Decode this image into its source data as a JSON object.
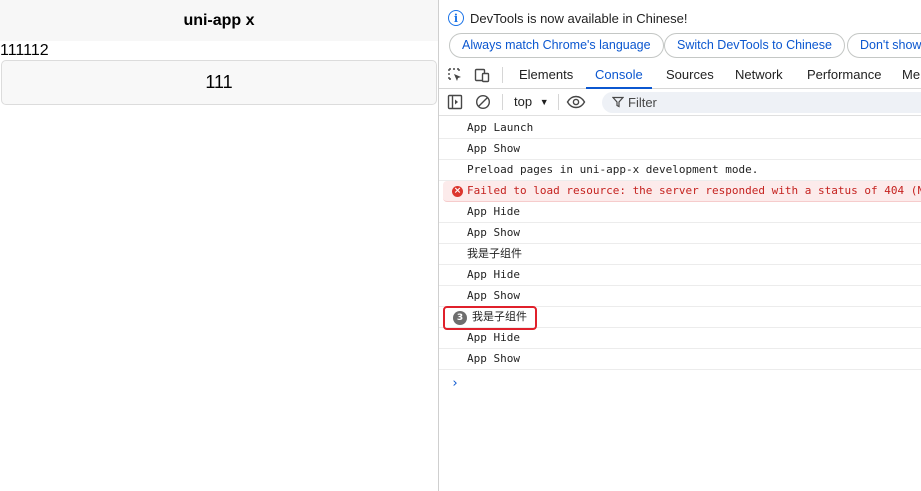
{
  "app": {
    "nav_title": "uni-app x",
    "text": "111112",
    "button_label": "111"
  },
  "devtools": {
    "infobar": {
      "message": "DevTools is now available in Chinese!",
      "buttons": [
        "Always match Chrome's language",
        "Switch DevTools to Chinese",
        "Don't show"
      ]
    },
    "tabs": [
      "Elements",
      "Console",
      "Sources",
      "Network",
      "Performance",
      "Me"
    ],
    "active_tab": "Console",
    "toolbar": {
      "context": "top",
      "filter_placeholder": "Filter"
    },
    "logs": [
      {
        "type": "log",
        "text": "App Launch"
      },
      {
        "type": "log",
        "text": "App Show"
      },
      {
        "type": "log",
        "text": "Preload pages in uni-app-x development mode."
      },
      {
        "type": "error",
        "text": "Failed to load resource: the server responded with a status of 404 (N"
      },
      {
        "type": "log",
        "text": "App Hide"
      },
      {
        "type": "log",
        "text": "App Show"
      },
      {
        "type": "log",
        "text": "我是子组件"
      },
      {
        "type": "log",
        "text": "App Hide"
      },
      {
        "type": "log",
        "text": "App Show"
      },
      {
        "type": "repeat",
        "count": "3",
        "text": "我是子组件"
      },
      {
        "type": "log",
        "text": "App Hide"
      },
      {
        "type": "log",
        "text": "App Show"
      }
    ],
    "prompt": "›"
  },
  "colors": {
    "accent": "#0b57d0",
    "error": "#dc362e",
    "highlight": "#e0202b"
  }
}
